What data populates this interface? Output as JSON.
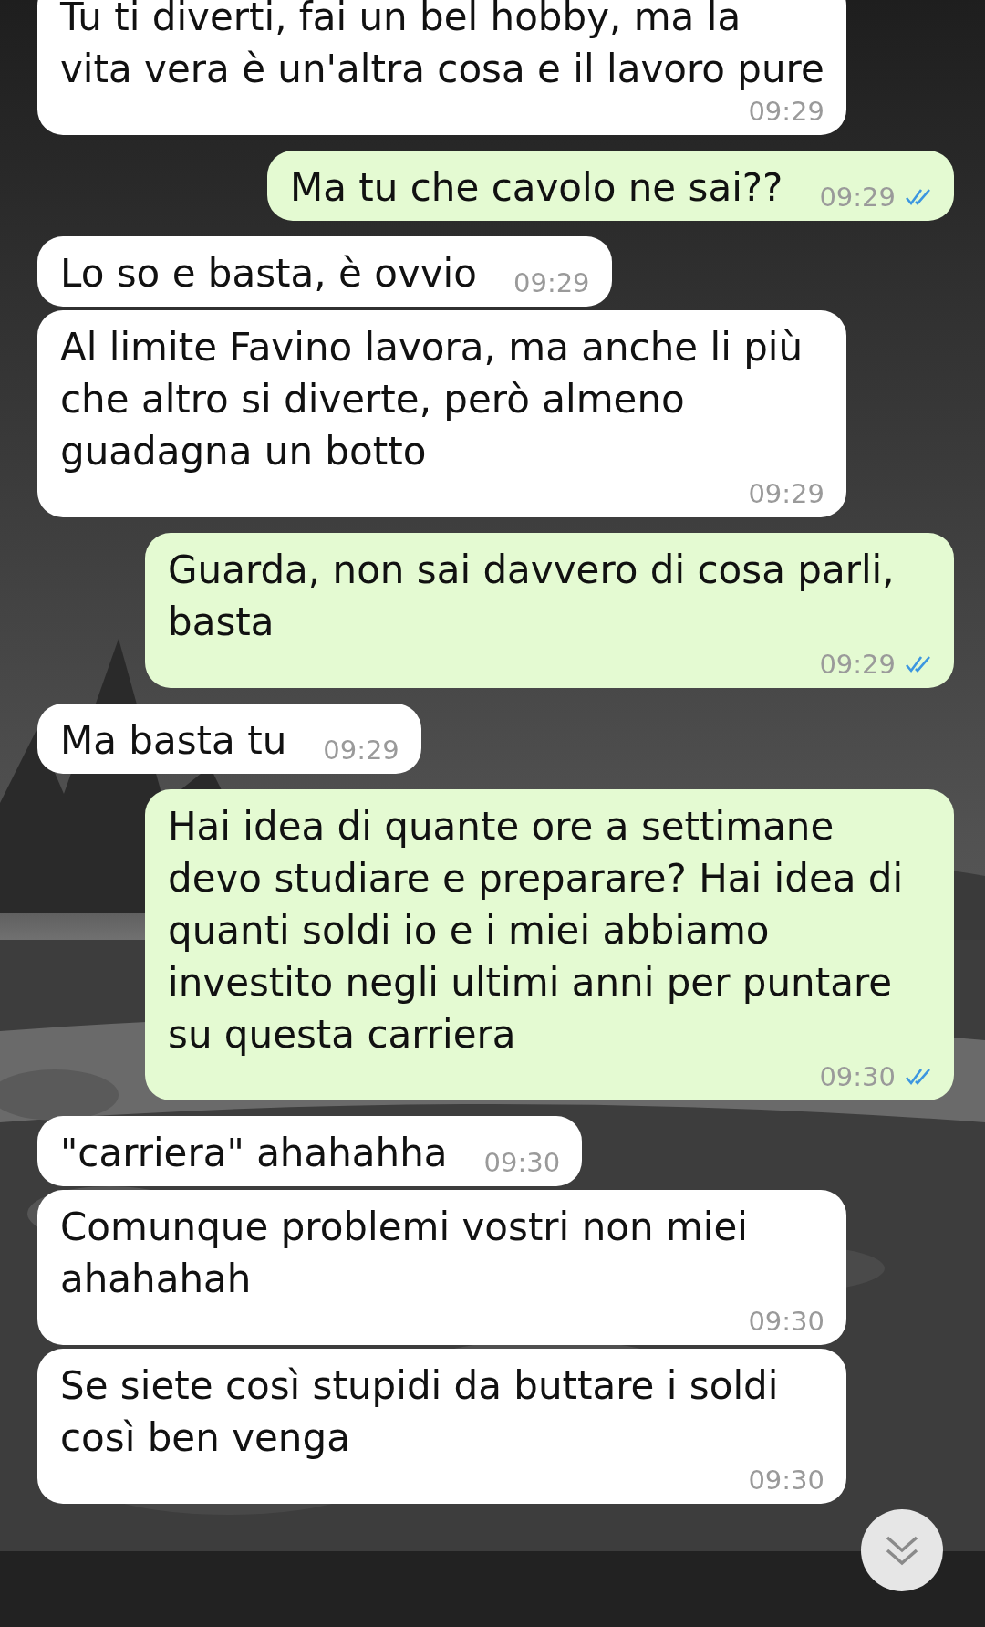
{
  "messages": [
    {
      "kind": "incoming",
      "text": "Tu ti diverti, fai un bel hobby, ma la vita vera è un'altra cosa e il lavoro pure",
      "time": "09:29"
    },
    {
      "kind": "outgoing",
      "text": "Ma tu che cavolo ne sai??",
      "time": "09:29",
      "read": true
    },
    {
      "kind": "incoming",
      "text": "Lo so e basta, è ovvio",
      "time": "09:29"
    },
    {
      "kind": "incoming",
      "text": "Al limite Favino lavora, ma anche li più che altro si diverte, però almeno guadagna un botto",
      "time": "09:29"
    },
    {
      "kind": "outgoing",
      "text": "Guarda, non sai davvero di cosa parli, basta",
      "time": "09:29",
      "read": true
    },
    {
      "kind": "incoming",
      "text": "Ma basta tu",
      "time": "09:29"
    },
    {
      "kind": "outgoing",
      "text": "Hai idea di quante ore a settimane devo studiare e preparare? Hai idea di quanti soldi io e i miei abbiamo investito negli ultimi anni per puntare su questa carriera",
      "time": "09:30",
      "read": true
    },
    {
      "kind": "incoming",
      "text": "\"carriera\" ahahahha",
      "time": "09:30"
    },
    {
      "kind": "incoming",
      "text": "Comunque problemi vostri non miei ahahahah",
      "time": "09:30"
    },
    {
      "kind": "incoming",
      "text": "Se siete così stupidi da buttare i soldi così ben venga",
      "time": "09:30"
    }
  ]
}
